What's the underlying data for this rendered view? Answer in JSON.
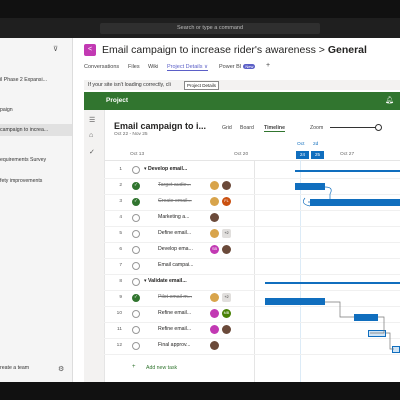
{
  "search": {
    "placeholder": "Search or type a command"
  },
  "sidebar": {
    "items": [
      {
        "label": "il Phase 2 Expansi..."
      },
      {
        "label": "paign"
      },
      {
        "label": "campaign to increa..."
      },
      {
        "label": "equirements Survey"
      },
      {
        "label": "fety improvements"
      }
    ],
    "create_team": "reate a team"
  },
  "channel": {
    "badge": "<",
    "title": "Email campaign to increase rider's awareness",
    "separator": " > ",
    "name": "General"
  },
  "tabs": [
    {
      "label": "Conversations"
    },
    {
      "label": "Files"
    },
    {
      "label": "Wiki"
    },
    {
      "label": "Project Details ∨"
    },
    {
      "label": "Power BI"
    },
    {
      "label": "+"
    }
  ],
  "new_badge": "New",
  "notice": {
    "text": "If your site isn't loading correctly, cli",
    "tooltip": "Project Details"
  },
  "project_header": {
    "label": "Project"
  },
  "project": {
    "title": "Email campaign to i...",
    "dates": "Oct 22 - Nov 25"
  },
  "views": [
    {
      "label": "Grid"
    },
    {
      "label": "Board"
    },
    {
      "label": "Timeline"
    }
  ],
  "zoom": {
    "label": "Zoom"
  },
  "timeline_header": {
    "oct13": "Oct 13",
    "oct20": "Oct 20",
    "oct": "Oct",
    "oct27": "Oct 27",
    "d2d": "2d",
    "day24": "24",
    "day25": "25"
  },
  "tasks": [
    {
      "num": "1",
      "name": "Develop email...",
      "state": "open",
      "summary": true
    },
    {
      "num": "2",
      "name": "Target audie...",
      "state": "done",
      "strike": true
    },
    {
      "num": "3",
      "name": "Create email...",
      "state": "done",
      "strike": true
    },
    {
      "num": "4",
      "name": "Marketing a...",
      "state": "open"
    },
    {
      "num": "5",
      "name": "Define email...",
      "state": "open",
      "extra": "+2"
    },
    {
      "num": "6",
      "name": "Develop ema...",
      "state": "open"
    },
    {
      "num": "7",
      "name": "Email campai...",
      "state": "open"
    },
    {
      "num": "8",
      "name": "Validate email...",
      "state": "open",
      "summary": true
    },
    {
      "num": "9",
      "name": "Pilot email m...",
      "state": "done",
      "strike": true,
      "extra": "+2"
    },
    {
      "num": "10",
      "name": "Refine email...",
      "state": "open"
    },
    {
      "num": "11",
      "name": "Refine email...",
      "state": "open"
    },
    {
      "num": "12",
      "name": "Final approv...",
      "state": "open"
    }
  ],
  "avatars": {
    "fl": "FL",
    "sb": "SB",
    "mb": "MB"
  },
  "add_task": {
    "label": "Add new task",
    "icon": "+"
  },
  "colors": {
    "accent": "#31752f",
    "bar": "#106ebe",
    "brand": "#c239b3"
  }
}
